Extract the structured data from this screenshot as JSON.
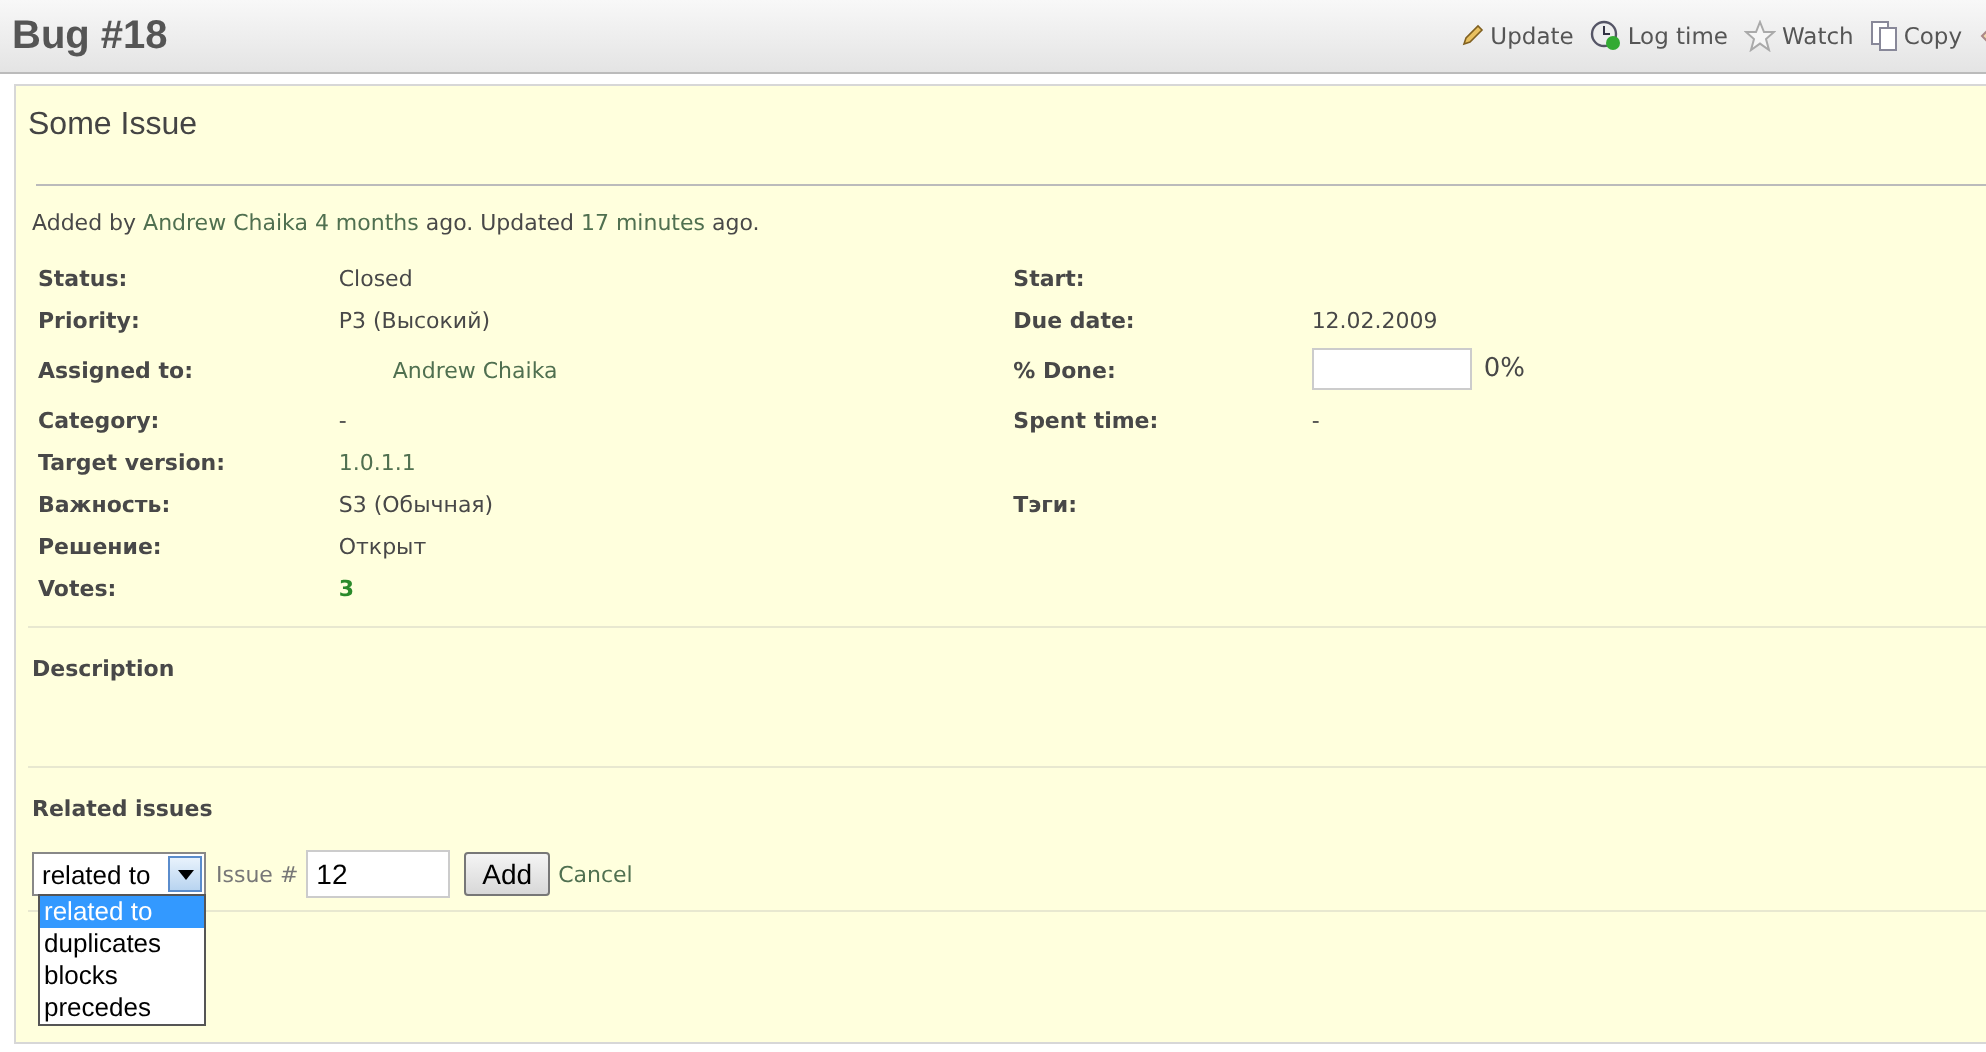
{
  "header": {
    "title": "Bug #18",
    "actions": [
      {
        "kind": "update",
        "label": "Update"
      },
      {
        "kind": "log_time",
        "label": "Log time"
      },
      {
        "kind": "watch",
        "label": "Watch"
      },
      {
        "kind": "copy",
        "label": "Copy"
      },
      {
        "kind": "move"
      }
    ]
  },
  "issue": {
    "subject": "Some Issue",
    "author_line": {
      "prefix": "Added by",
      "author": "Andrew Chaika",
      "age": "4 months",
      "middle": "ago. Updated",
      "updated": "17 minutes",
      "suffix": "ago."
    },
    "rows": [
      {
        "left": {
          "label": "Status:",
          "kind": "plain",
          "value": "Closed"
        },
        "right": {
          "label": "Start:",
          "kind": "plain"
        }
      },
      {
        "left": {
          "label": "Priority:",
          "kind": "plain",
          "value": "P3 (Высокий)"
        },
        "right": {
          "label": "Due date:",
          "kind": "plain",
          "value": "12.02.2009"
        }
      },
      {
        "left": {
          "label": "Assigned to:",
          "kind": "user",
          "value": "Andrew Chaika"
        },
        "right": {
          "label": "% Done:",
          "kind": "progress",
          "level": 0,
          "reading": "0%"
        }
      },
      {
        "left": {
          "label": "Category:",
          "kind": "plain",
          "value": "-"
        },
        "right": {
          "label": "Spent time:",
          "kind": "plain",
          "value": "-"
        }
      },
      {
        "left": {
          "label": "Target version:",
          "kind": "link",
          "value": "1.0.1.1"
        }
      },
      {
        "left": {
          "label": "Важность:",
          "kind": "plain",
          "value": "S3 (Обычная)"
        },
        "right": {
          "label": "Тэги:",
          "kind": "plain"
        }
      },
      {
        "left": {
          "label": "Решение:",
          "kind": "plain",
          "value": "Открыт"
        }
      },
      {
        "left": {
          "label": "Votes:",
          "kind": "count",
          "value": "3"
        }
      }
    ],
    "description": {
      "heading": "Description"
    },
    "related": {
      "heading": "Related issues",
      "relation": {
        "value": "related to",
        "expanded": true,
        "options": [
          {
            "label": "related to",
            "selected": true
          },
          {
            "label": "duplicates",
            "selected": false
          },
          {
            "label": "blocks",
            "selected": false
          },
          {
            "label": "precedes",
            "selected": false
          }
        ]
      },
      "issue_label": "Issue #",
      "issue_value": "12",
      "add": "Add",
      "cancel": "Cancel"
    }
  }
}
